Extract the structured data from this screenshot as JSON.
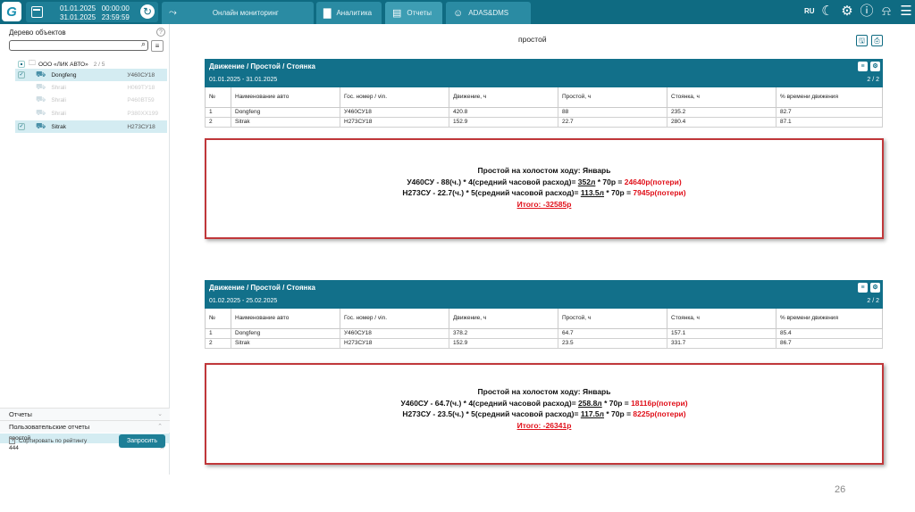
{
  "topbar": {
    "logo": "G",
    "date_from": "01.01.2025   00:00:00",
    "date_to": "31.01.2025   23:59:59",
    "tabs": [
      {
        "label": "Онлайн мониторинг"
      },
      {
        "label": "Аналитика"
      },
      {
        "label": "Отчеты"
      },
      {
        "label": "ADAS&DMS"
      }
    ],
    "lang": "RU"
  },
  "sidebar": {
    "title": "Дерево объектов",
    "search_placeholder": "",
    "org": {
      "name": "ООО «ЛИК АВТО»",
      "count": "2 / 5"
    },
    "vehicles": [
      {
        "name": "Dongfeng",
        "plate": "У460СУ18"
      },
      {
        "name": "Shrali",
        "plate": "Н069ТУ18"
      },
      {
        "name": "Shrali",
        "plate": "Р460ВТ59"
      },
      {
        "name": "Shrali",
        "plate": "Р380ХХ199"
      },
      {
        "name": "Sitrak",
        "plate": "Н273СУ18"
      }
    ],
    "sections": {
      "reports": "Отчеты",
      "custom_reports": "Пользовательские отчеты"
    },
    "custom_items": [
      "простой",
      "444"
    ],
    "sort_label": "Сортировать по рейтингу",
    "request_button": "Запросить"
  },
  "main": {
    "title": "простой",
    "reports": [
      {
        "header": "Движение / Простой / Стоянка",
        "period": "01.01.2025 - 31.01.2025",
        "page": "2 / 2",
        "columns": [
          "№",
          "Наименование авто",
          "Гос. номер / vin.",
          "Движение, ч",
          "Простой, ч",
          "Стоянка, ч",
          "% времени движения"
        ],
        "rows": [
          [
            "1",
            "Dongfeng",
            "У460СУ18",
            "420.8",
            "88",
            "235.2",
            "82.7"
          ],
          [
            "2",
            "Sitrak",
            "Н273СУ18",
            "152.9",
            "22.7",
            "280.4",
            "87.1"
          ]
        ]
      },
      {
        "header": "Движение / Простой / Стоянка",
        "period": "01.02.2025 - 25.02.2025",
        "page": "2 / 2",
        "columns": [
          "№",
          "Наименование авто",
          "Гос. номер / vin.",
          "Движение, ч",
          "Простой, ч",
          "Стоянка, ч",
          "% времени движения"
        ],
        "rows": [
          [
            "1",
            "Dongfeng",
            "У460СУ18",
            "378.2",
            "64.7",
            "157.1",
            "85.4"
          ],
          [
            "2",
            "Sitrak",
            "Н273СУ18",
            "152.9",
            "23.5",
            "331.7",
            "86.7"
          ]
        ]
      }
    ],
    "annotations": [
      {
        "title": "Простой на холостом ходу: Январь",
        "line1_a": "У460СУ - 88(ч.) * 4(средний часовой расход)= ",
        "line1_b": "352л",
        "line1_c": " * 70р = ",
        "line1_d": "24640р(потери)",
        "line2_a": "Н273СУ - 22.7(ч.) * 5(средний часовой расход)= ",
        "line2_b": "113.5л",
        "line2_c": " * 70р = ",
        "line2_d": "7945р(потери)",
        "total": "Итого: -32585р"
      },
      {
        "title": "Простой на холостом ходу: Январь",
        "line1_a": "У460СУ - 64.7(ч.) * 4(средний часовой расход)= ",
        "line1_b": "258.8л",
        "line1_c": " * 70р = ",
        "line1_d": "18116р(потери)",
        "line2_a": "Н273СУ - 23.5(ч.) * 5(средний часовой расход)= ",
        "line2_b": "117.5л",
        "line2_c": " * 70р = ",
        "line2_d": "8225р(потери)",
        "total": "Итого: -26341р"
      }
    ]
  },
  "slide_number": "26",
  "colors": {
    "primary": "#0f6b82",
    "loss": "#e0101a",
    "box_border": "#c0373a"
  }
}
